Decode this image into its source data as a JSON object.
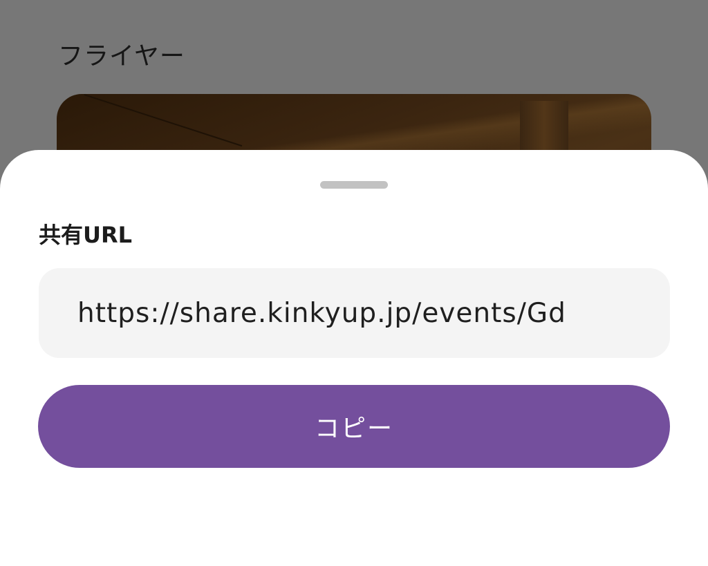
{
  "background": {
    "title": "フライヤー"
  },
  "share_sheet": {
    "title": "共有URL",
    "url_value": "https://share.kinkyup.jp/events/Gd",
    "copy_label": "コピー"
  },
  "colors": {
    "accent": "#744f9d",
    "overlay": "#777777",
    "field_bg": "#f4f4f4",
    "handle": "#c2c2c2"
  }
}
